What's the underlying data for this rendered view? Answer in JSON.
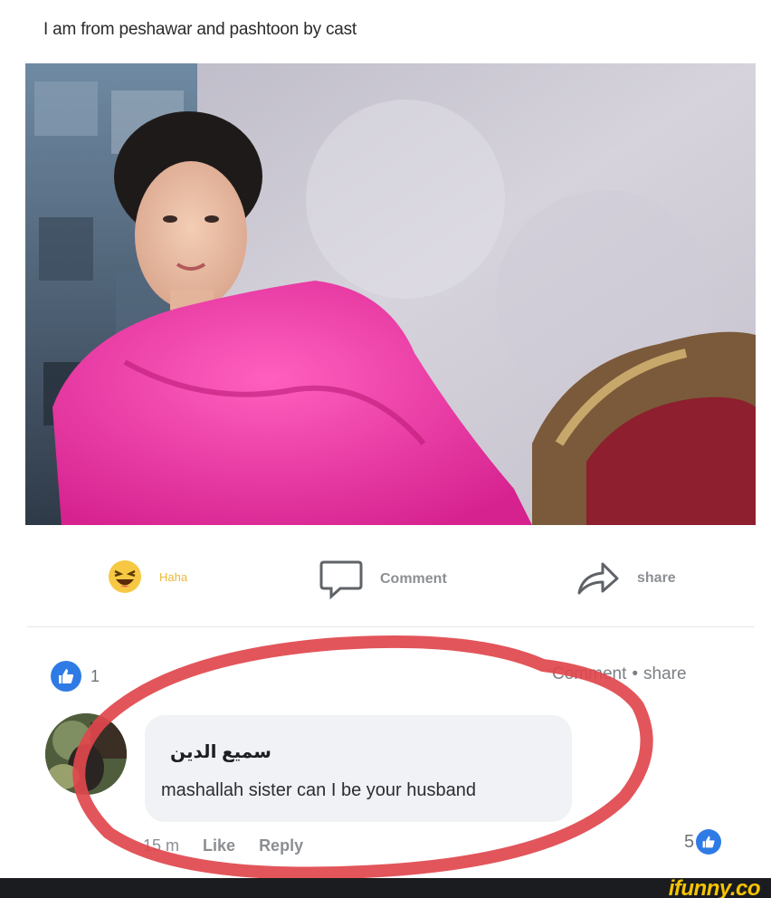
{
  "post": {
    "caption": "I am from peshawar and pashtoon by cast"
  },
  "actions": {
    "haha_label": "Haha",
    "comment_label": "Comment",
    "share_label": "share"
  },
  "reactions": {
    "count": "1"
  },
  "top_links": {
    "comment_label": "Comment",
    "separator": "•",
    "share_label": "share"
  },
  "comment": {
    "author": "سميع الدين",
    "text": "mashallah sister can I be your husband",
    "time": "15 m",
    "like_label": "Like",
    "reply_label": "Reply",
    "like_count": "5"
  },
  "footer": {
    "logo": "ifunny.co"
  },
  "colors": {
    "like_blue": "#2f7be5",
    "overlay_red": "#e0474c",
    "logo_yellow": "#f6c400"
  },
  "icons": [
    "haha-emoji-icon",
    "comment-bubble-icon",
    "share-arrow-icon",
    "thumbs-up-icon"
  ]
}
